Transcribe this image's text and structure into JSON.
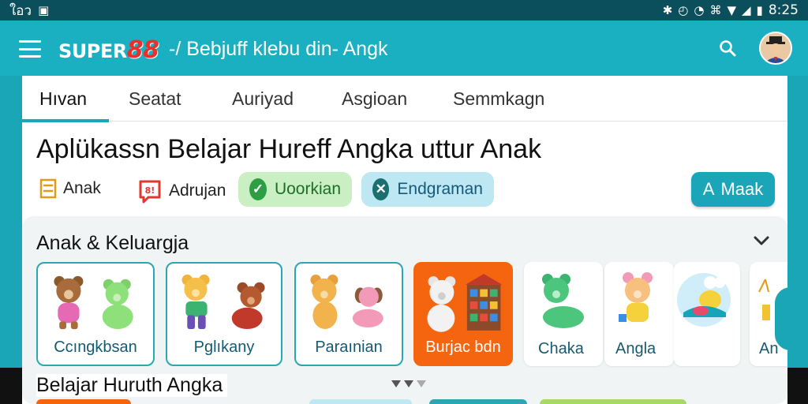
{
  "status_bar": {
    "left_text": "ใอว",
    "right_time": "8:25"
  },
  "app_bar": {
    "logo_text": "SUPER",
    "logo_number": "88",
    "title": "-/ Bebjuff klebu din- Angk"
  },
  "tabs": [
    {
      "label": "Hıvan",
      "active": true
    },
    {
      "label": "Seatat",
      "active": false
    },
    {
      "label": "Auriyad",
      "active": false
    },
    {
      "label": "Asgioan",
      "active": false
    },
    {
      "label": "Semmkagn",
      "active": false
    }
  ],
  "page_title": "Aplükassn Belajar Hureff Angka uttur Anak",
  "meta": {
    "item1_label": "Anak",
    "item2_label": "Adrujan",
    "pill1_label": "Uoorkian",
    "pill2_label": "Endgraman",
    "main_button_label": "Maak",
    "main_button_icon": "A"
  },
  "section_title": "Anak & Keluargja",
  "categories": [
    {
      "label": "Ccıngkbsan"
    },
    {
      "label": "Pglıkany"
    },
    {
      "label": "Paraınian"
    },
    {
      "label": "Burjac bdn"
    },
    {
      "label": "Chaka"
    },
    {
      "label": "Angla"
    },
    {
      "label": "An"
    }
  ],
  "sub_title": "Belajar Huruth Angka",
  "colors": {
    "accent": "#1ab0c1",
    "selected": "#f5650f",
    "status_bar": "#0b4f5c"
  }
}
